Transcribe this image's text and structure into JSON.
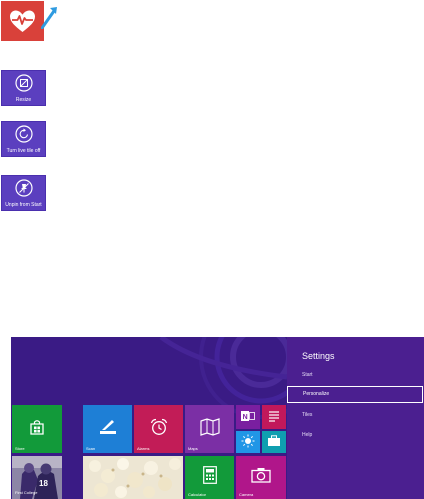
{
  "illustration": {
    "health_icon": "heart-pulse-icon",
    "health_color": "#d9413a",
    "arrow_icon": "arrow-up-right-icon",
    "arrow_color": "#2f9be0"
  },
  "commands": [
    {
      "label": "Resize",
      "icon": "resize-icon"
    },
    {
      "label": "Turn live tile off",
      "icon": "live-tile-off-icon"
    },
    {
      "label": "Unpin from Start",
      "icon": "unpin-icon"
    }
  ],
  "start_screen": {
    "tiles": {
      "store": "Store",
      "scan": "Scan",
      "alarms": "Alarms",
      "maps": "Maps",
      "first_college": "First College",
      "calculator": "Calculator",
      "camera": "Camera"
    },
    "colors": {
      "background": "#3a1b85",
      "store": "#129a3a",
      "scan": "#1e7fd6",
      "alarms": "#c21c57",
      "maps": "#7b2fa5",
      "calculator": "#129a3a",
      "camera": "#b0168a"
    }
  },
  "settings_charm": {
    "title": "Settings",
    "items": [
      {
        "label": "Start"
      },
      {
        "label": "Personalize",
        "selected": true
      },
      {
        "label": "Tiles"
      },
      {
        "label": "Help"
      }
    ]
  }
}
